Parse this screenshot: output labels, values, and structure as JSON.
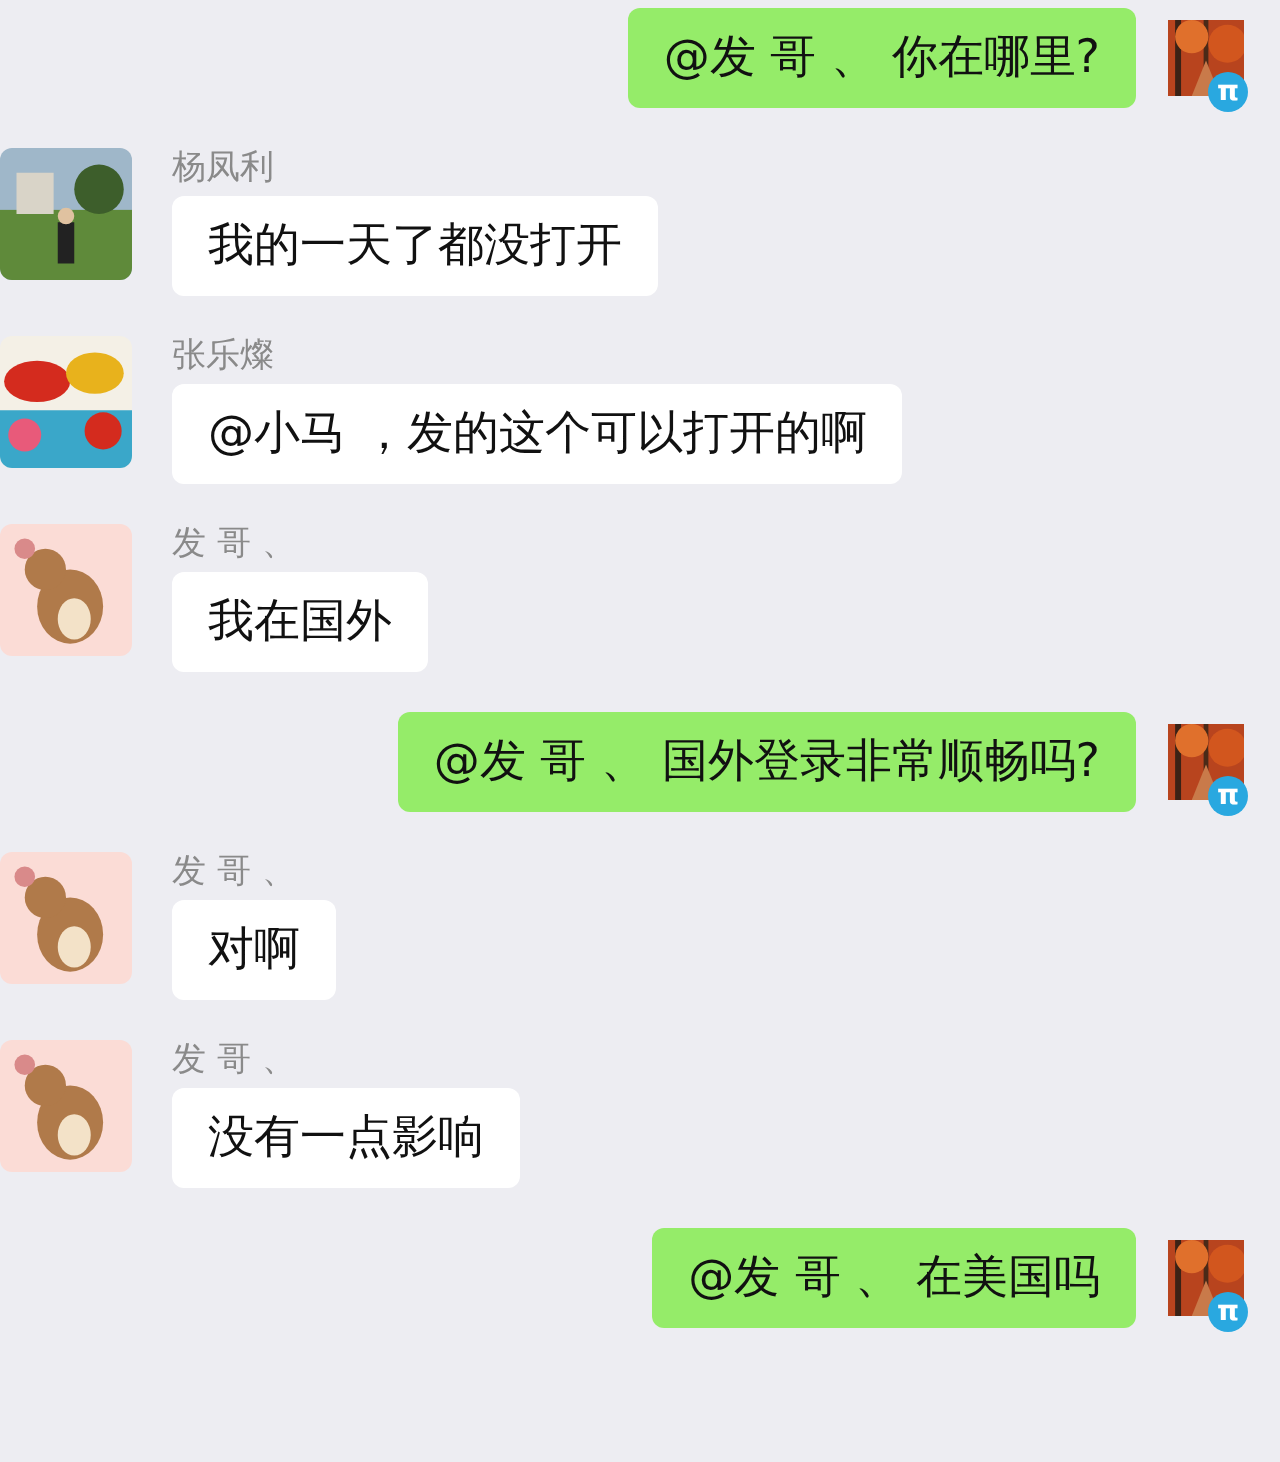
{
  "messages": [
    {
      "kind": "sent",
      "text": "@发 哥 、 你在哪里?",
      "badge": "π"
    },
    {
      "kind": "received",
      "sender": "杨凤利",
      "text": "我的一天了都没打开"
    },
    {
      "kind": "received",
      "sender": "张乐燦",
      "text": "@小马 ，发的这个可以打开的啊"
    },
    {
      "kind": "received",
      "sender": "发 哥 、",
      "text": "我在国外"
    },
    {
      "kind": "sent",
      "text": "@发 哥 、 国外登录非常顺畅吗?",
      "badge": "π"
    },
    {
      "kind": "received",
      "sender": "发 哥 、",
      "text": "对啊"
    },
    {
      "kind": "received",
      "sender": "发 哥 、",
      "text": "没有一点影响"
    },
    {
      "kind": "sent",
      "text": "@发 哥 、 在美国吗",
      "badge": "π"
    }
  ]
}
